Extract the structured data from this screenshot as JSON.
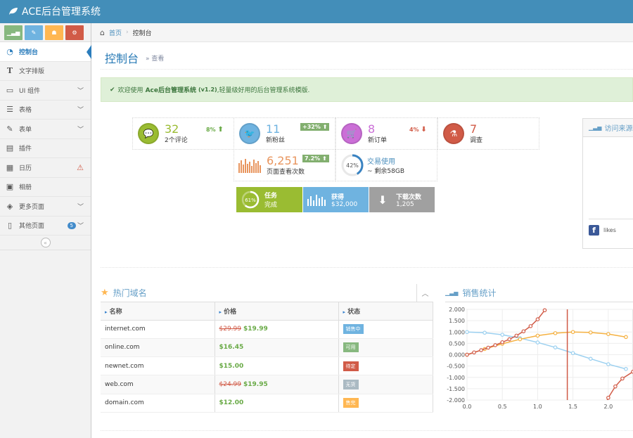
{
  "app": {
    "title": "ACE后台管理系统"
  },
  "breadcrumb": {
    "home": "首页",
    "current": "控制台"
  },
  "page": {
    "title": "控制台",
    "subtitle": "» 查看"
  },
  "sidebar": {
    "items": [
      {
        "label": "控制台",
        "icon": "dashboard-icon",
        "active": true
      },
      {
        "label": "文字排版",
        "icon": "text-icon"
      },
      {
        "label": "UI 组件",
        "icon": "desktop-icon",
        "caret": true
      },
      {
        "label": "表格",
        "icon": "list-icon",
        "caret": true
      },
      {
        "label": "表单",
        "icon": "edit-icon",
        "caret": true
      },
      {
        "label": "插件",
        "icon": "widget-icon"
      },
      {
        "label": "日历",
        "icon": "calendar-icon",
        "warning": true
      },
      {
        "label": "相册",
        "icon": "picture-icon"
      },
      {
        "label": "更多页面",
        "icon": "tag-icon",
        "caret": true
      },
      {
        "label": "其他页面",
        "icon": "file-icon",
        "caret": true,
        "badge": "5"
      }
    ],
    "shortcut_colors": [
      "#87b87f",
      "#6fb3e0",
      "#ffb752",
      "#d15b47"
    ]
  },
  "alert": {
    "text_prefix": "欢迎使用",
    "brand": "Ace后台管理系统",
    "version": "(v1.2)",
    "text_suffix": ",轻量级好用的后台管理系统模版."
  },
  "infoboxes": {
    "comments": {
      "value": "32",
      "label": "2个评论",
      "stat": "8%"
    },
    "followers": {
      "value": "11",
      "label": "新粉丝",
      "stat": "+32%"
    },
    "orders": {
      "value": "8",
      "label": "新订单",
      "stat": "4%"
    },
    "survey": {
      "value": "7",
      "label": "调查"
    },
    "pageviews": {
      "value": "6,251",
      "label": "页面查看次数",
      "stat": "7.2%"
    },
    "traffic": {
      "percent": "42%",
      "title": "交易使用",
      "sub": "~ 剩余58GB"
    },
    "tasks": {
      "percent": "61%",
      "title": "任务",
      "sub": "完成"
    },
    "earnings": {
      "title": "获得",
      "sub": "$32,000"
    },
    "downloads": {
      "title": "下载次数",
      "sub": "1,205"
    }
  },
  "visits": {
    "title": "访问来源",
    "facebook": "likes"
  },
  "domains": {
    "title": "热门域名",
    "columns": [
      "名称",
      "价格",
      "状态"
    ],
    "rows": [
      {
        "name": "internet.com",
        "old": "$29.99",
        "price": "$19.99",
        "status": "销售中",
        "color": "#6fb3e0"
      },
      {
        "name": "online.com",
        "old": "",
        "price": "$16.45",
        "status": "可用",
        "color": "#87b87f"
      },
      {
        "name": "newnet.com",
        "old": "",
        "price": "$15.00",
        "status": "待定",
        "color": "#d15b47"
      },
      {
        "name": "web.com",
        "old": "$24.99",
        "price": "$19.95",
        "status": "无货",
        "color": "#abbac3"
      },
      {
        "name": "domain.com",
        "old": "",
        "price": "$12.00",
        "status": "售完",
        "color": "#ffb752"
      }
    ]
  },
  "sales": {
    "title": "销售统计"
  },
  "chart_data": {
    "type": "line",
    "title": "销售统计",
    "x_ticks": [
      0.0,
      0.5,
      1.0,
      1.5,
      2.0
    ],
    "y_ticks": [
      2.0,
      1.5,
      1.0,
      0.5,
      0.0,
      -0.5,
      -1.0,
      -1.5,
      -2.0
    ],
    "xlim": [
      0,
      2.35
    ],
    "ylim": [
      -2,
      2
    ],
    "series": [
      {
        "color": "#9bd0f0",
        "x": [
          0,
          0.25,
          0.5,
          0.75,
          1.0,
          1.25,
          1.5,
          1.75,
          2.0,
          2.25
        ],
        "y": [
          1.0,
          0.97,
          0.88,
          0.73,
          0.54,
          0.32,
          0.07,
          -0.18,
          -0.42,
          -0.63
        ]
      },
      {
        "color": "#f5b141",
        "x": [
          0,
          0.25,
          0.5,
          0.75,
          1.0,
          1.25,
          1.5,
          1.75,
          2.0,
          2.25
        ],
        "y": [
          0.0,
          0.25,
          0.48,
          0.68,
          0.84,
          0.95,
          1.0,
          0.98,
          0.91,
          0.78
        ]
      },
      {
        "color": "#d15b47",
        "x": [
          0,
          0.1,
          0.2,
          0.3,
          0.4,
          0.5,
          0.6,
          0.7,
          0.8,
          0.9,
          1.0,
          1.1,
          1.2,
          1.3
        ],
        "y": [
          0.0,
          0.1,
          0.2,
          0.31,
          0.42,
          0.55,
          0.68,
          0.84,
          1.03,
          1.26,
          1.56,
          1.96,
          2.57,
          3.6
        ]
      },
      {
        "color": "#d15b47",
        "x": [
          1.42,
          1.42
        ],
        "y": [
          2.0,
          -2.0
        ]
      },
      {
        "color": "#d15b47",
        "x": [
          1.9,
          2.0,
          2.1,
          2.2,
          2.35
        ],
        "y": [
          -2.6,
          -1.9,
          -1.4,
          -1.05,
          -0.75
        ]
      }
    ]
  }
}
